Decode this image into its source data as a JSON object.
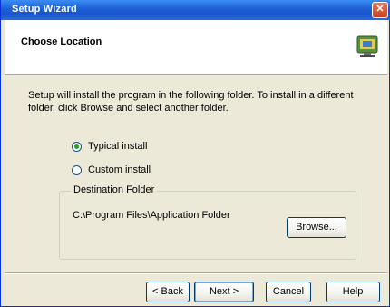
{
  "window": {
    "title": "Setup Wizard",
    "close_glyph": "✕"
  },
  "header": {
    "title": "Choose Location",
    "icon": "setup-icon"
  },
  "description": "Setup will install the program in the following folder. To install in a different folder, click Browse and select another folder.",
  "install_options": {
    "selected_index": 0,
    "options": [
      {
        "label": "Typical install"
      },
      {
        "label": "Custom install"
      }
    ]
  },
  "destination": {
    "group_label": "Destination Folder",
    "path": "C:\\Program Files\\Application Folder",
    "browse_label": "Browse..."
  },
  "footer": {
    "back_label": "< Back",
    "next_label": "Next >",
    "cancel_label": "Cancel",
    "help_label": "Help",
    "default_button": "next"
  },
  "colors": {
    "titlebar": "#1d5fd6",
    "dialog_bg": "#ece9d8",
    "header_bg": "#ffffff",
    "button_border": "#003c74"
  }
}
